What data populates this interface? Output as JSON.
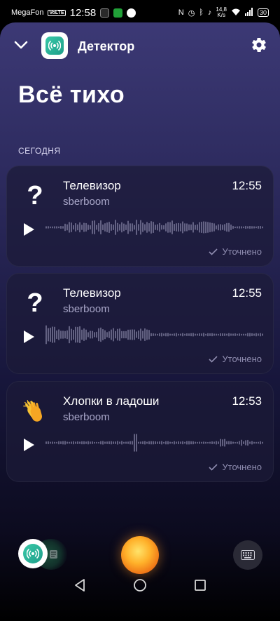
{
  "status_bar": {
    "carrier": "MegaFon",
    "network_badge": "VoLTE",
    "time": "12:58",
    "speed_value": "14,8",
    "speed_unit": "K/s",
    "battery": "30"
  },
  "header": {
    "title": "Детектор",
    "icons": {
      "back": "chevron-down-icon",
      "settings": "gear-icon",
      "logo": "sound-wave-logo-icon"
    }
  },
  "main": {
    "headline": "Всё тихо",
    "section_label": "СЕГОДНЯ",
    "events": [
      {
        "title": "Телевизор",
        "source": "sberboom",
        "time": "12:55",
        "status": "Уточнено",
        "icon": "question-mark-icon"
      },
      {
        "title": "Телевизор",
        "source": "sberboom",
        "time": "12:55",
        "status": "Уточнено",
        "icon": "question-mark-icon"
      },
      {
        "title": "Хлопки в ладоши",
        "source": "sberboom",
        "time": "12:53",
        "status": "Уточнено",
        "icon": "clapping-hands-icon"
      }
    ]
  },
  "bottom_bar": {
    "icons": [
      "detector-app-icon",
      "other-app-icon",
      "assistant-orb-icon",
      "keyboard-icon"
    ]
  },
  "nav": {
    "icons": [
      "back-triangle-icon",
      "home-circle-icon",
      "recents-square-icon"
    ]
  },
  "colors": {
    "accent": "#39c9a8",
    "orb": "#ffb12a",
    "text_muted": "#a9a7c9",
    "card_bg": "#1c1b38"
  }
}
